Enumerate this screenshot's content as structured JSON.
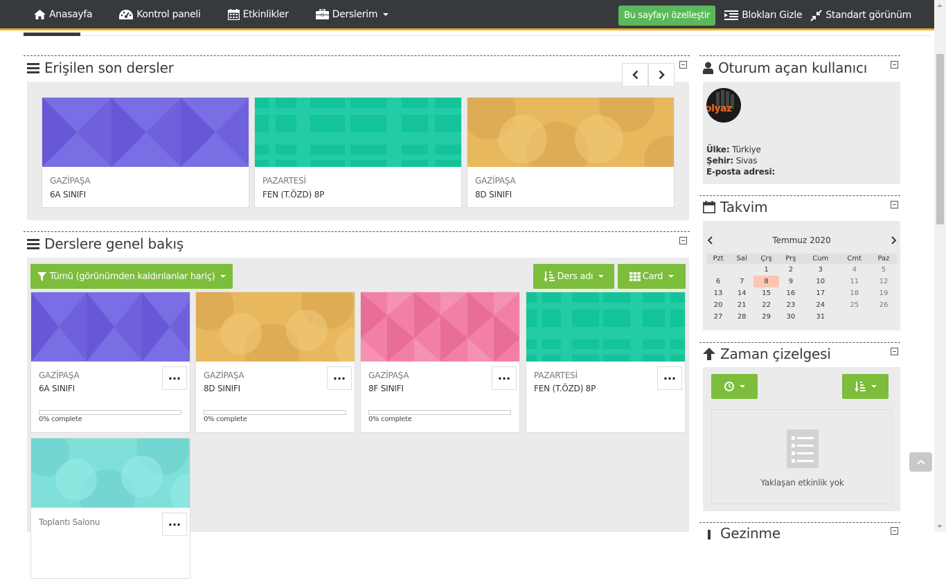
{
  "nav": {
    "home": "Anasayfa",
    "dashboard": "Kontrol paneli",
    "events": "Etkinlikler",
    "my_courses": "Derslerim",
    "customize": "Bu sayfayı özelleştir",
    "hide_blocks": "Blokları Gizle",
    "standard_view": "Standart görünüm"
  },
  "recent": {
    "title": "Erişilen son dersler",
    "cards": [
      {
        "category": "GAZİPAŞA",
        "name": "6A SINIFI",
        "color": "#6f61dc"
      },
      {
        "category": "PAZARTESİ",
        "name": "FEN (T.ÖZD) 8P",
        "color": "#13c39a"
      },
      {
        "category": "GAZİPAŞA",
        "name": "8D SINIFI",
        "color": "#e8b85e"
      }
    ]
  },
  "overview": {
    "title": "Derslere genel bakış",
    "filter_label": "Tümü (görünümden kaldırılanlar hariç)",
    "sort_label": "Ders adı",
    "view_label": "Card",
    "more_label": "...",
    "cards": [
      {
        "category": "GAZİPAŞA",
        "name": "6A SINIFI",
        "percent": 0,
        "progress_text": "0% complete",
        "color": "#6f61dc"
      },
      {
        "category": "GAZİPAŞA",
        "name": "8D SINIFI",
        "percent": 0,
        "progress_text": "0% complete",
        "color": "#e8b85e"
      },
      {
        "category": "GAZİPAŞA",
        "name": "8F SINIFI",
        "percent": 0,
        "progress_text": "0% complete",
        "color": "#f27fa6"
      },
      {
        "category": "PAZARTESİ",
        "name": "FEN (T.ÖZD) 8P",
        "color": "#13c39a"
      },
      {
        "category": "Toplantı Salonu",
        "name": "",
        "color": "#7fe0da"
      }
    ]
  },
  "user": {
    "title": "Oturum açan kullanıcı",
    "avatar_text": "olyaz",
    "country_label": "Ülke:",
    "country": "Türkiye",
    "city_label": "Şehir:",
    "city": "Sivas",
    "email_label": "E-posta adresi:"
  },
  "calendar": {
    "title": "Takvim",
    "month": "Temmuz 2020",
    "days": [
      "Pzt",
      "Sal",
      "Çrş",
      "Prş",
      "Cum",
      "Cmt",
      "Paz"
    ],
    "weeks": [
      [
        "",
        "",
        "1",
        "2",
        "3",
        "4",
        "5"
      ],
      [
        "6",
        "7",
        "8",
        "9",
        "10",
        "11",
        "12"
      ],
      [
        "13",
        "14",
        "15",
        "16",
        "17",
        "18",
        "19"
      ],
      [
        "20",
        "21",
        "22",
        "23",
        "24",
        "25",
        "26"
      ],
      [
        "27",
        "28",
        "29",
        "30",
        "31",
        "",
        ""
      ]
    ],
    "today": "8"
  },
  "timeline": {
    "title": "Zaman çizelgesi",
    "empty_text": "Yaklaşan etkinlik yok"
  },
  "next_block": {
    "title": "Gezinme"
  },
  "colors": {
    "navbar": "#373a3c",
    "accent": "#f0ad1e",
    "green": "#7cbd3c",
    "customize": "#5cb85c"
  }
}
